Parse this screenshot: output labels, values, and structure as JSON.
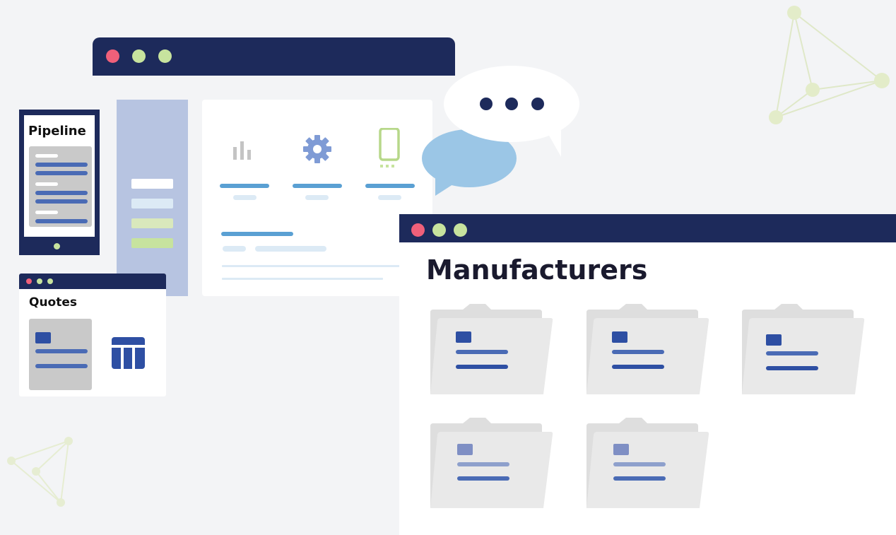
{
  "colors": {
    "navy": "#1d2a5b",
    "red_dot": "#f0607a",
    "green_dot": "#c7e39e",
    "sidebar": "#b7c4e1",
    "blue_line": "#5aa0d3",
    "light_blue": "#dceaf5",
    "panel_bg": "#ffffff",
    "folder_gray": "#e6e6e6"
  },
  "labels": {
    "pipeline": "Pipeline",
    "quotes": "Quotes",
    "manufacturers": "Manufacturers"
  },
  "icons": {
    "chart": "bar-chart-icon",
    "settings": "gear-icon",
    "mobile": "phone-icon",
    "table": "table-icon",
    "typing": "ellipsis-icon"
  }
}
